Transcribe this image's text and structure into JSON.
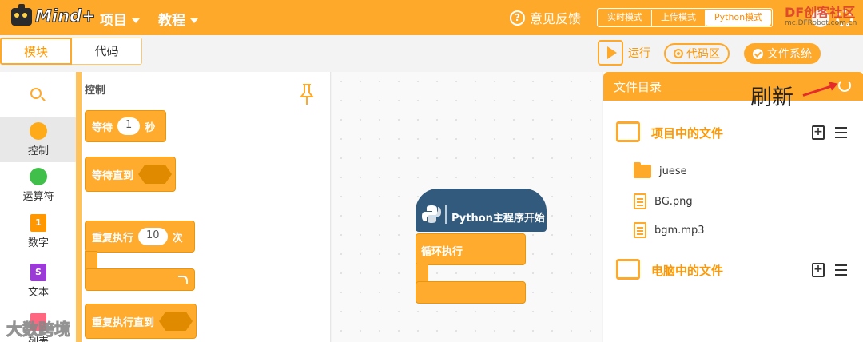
{
  "app": {
    "logo_text": "Mind+"
  },
  "header": {
    "menus": [
      {
        "label": "项目"
      },
      {
        "label": "教程"
      }
    ],
    "feedback": "意见反馈",
    "modes": [
      "实时模式",
      "上传模式",
      "Python模式"
    ],
    "active_mode": "Python模式",
    "watermark_top": "DF创客社区",
    "watermark_url": "mc.DFRobot.com.cn"
  },
  "toolbar": {
    "tabs": [
      "模块",
      "代码"
    ],
    "run_label": "运行",
    "code_area_label": "代码区",
    "file_system_label": "文件系统"
  },
  "categories": [
    {
      "label": "控制",
      "color": "#ffab19"
    },
    {
      "label": "运算符",
      "color": "#40bf4a"
    },
    {
      "label": "数字",
      "color": "#ff9800",
      "badge": "1"
    },
    {
      "label": "文本",
      "color": "#9b3ad6",
      "badge": "S"
    },
    {
      "label": "列表",
      "color": "#ff6680"
    }
  ],
  "palette": {
    "title": "控制",
    "blocks": {
      "wait_prefix": "等待",
      "wait_value": "1",
      "wait_suffix": "秒",
      "wait_until": "等待直到",
      "repeat_prefix": "重复执行",
      "repeat_value": "10",
      "repeat_suffix": "次",
      "repeat_until": "重复执行直到"
    }
  },
  "canvas": {
    "start_block": "Python主程序开始",
    "loop_block": "循环执行"
  },
  "files": {
    "title": "文件目录",
    "annotation": "刷新",
    "project_section": "项目中的文件",
    "items": [
      {
        "name": "juese",
        "kind": "folder"
      },
      {
        "name": "BG.png",
        "kind": "file"
      },
      {
        "name": "bgm.mp3",
        "kind": "file"
      }
    ],
    "computer_section": "电脑中的文件"
  },
  "watermark_bottom": "大数跨境",
  "colors": {
    "accent": "#ffa92b",
    "python_block": "#315a7c"
  }
}
